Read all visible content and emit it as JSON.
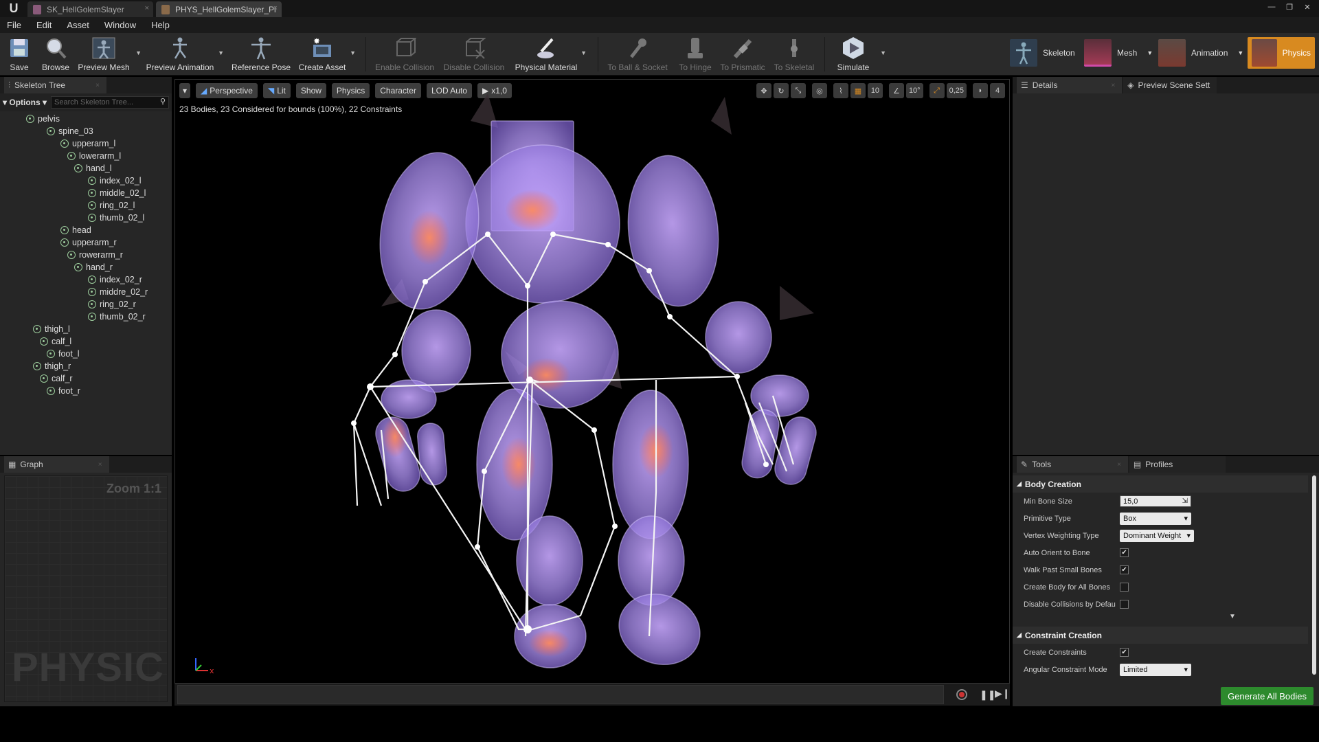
{
  "window": {
    "tabs": [
      {
        "label": "SK_HellGolemSlayer"
      },
      {
        "label": "PHYS_HellGolemSlayer_Pl"
      }
    ]
  },
  "menu": [
    "File",
    "Edit",
    "Asset",
    "Window",
    "Help"
  ],
  "toolbar": {
    "save": "Save",
    "browse": "Browse",
    "preview_mesh": "Preview Mesh",
    "preview_animation": "Preview Animation",
    "reference_pose": "Reference Pose",
    "create_asset": "Create Asset",
    "enable_collision": "Enable Collision",
    "disable_collision": "Disable Collision",
    "physical_material": "Physical Material",
    "to_ball_socket": "To Ball & Socket",
    "to_hinge": "To Hinge",
    "to_prismatic": "To Prismatic",
    "to_skeletal": "To Skeletal",
    "simulate": "Simulate"
  },
  "modes": {
    "skeleton": "Skeleton",
    "mesh": "Mesh",
    "animation": "Animation",
    "physics": "Physics"
  },
  "skeleton_tree": {
    "tab": "Skeleton Tree",
    "options": "Options",
    "search_placeholder": "Search Skeleton Tree...",
    "bones": [
      {
        "name": "pelvis",
        "level": 0
      },
      {
        "name": "spine_03",
        "level": 1
      },
      {
        "name": "upperarm_l",
        "level": 2
      },
      {
        "name": "lowerarm_l",
        "level": 3
      },
      {
        "name": "hand_l",
        "level": 4
      },
      {
        "name": "index_02_l",
        "level": 5
      },
      {
        "name": "middle_02_l",
        "level": 5
      },
      {
        "name": "ring_02_l",
        "level": 5
      },
      {
        "name": "thumb_02_l",
        "level": 5
      },
      {
        "name": "head",
        "level": 2
      },
      {
        "name": "upperarm_r",
        "level": 2
      },
      {
        "name": "rowerarm_r",
        "level": 3
      },
      {
        "name": "hand_r",
        "level": 4
      },
      {
        "name": "index_02_r",
        "level": 5
      },
      {
        "name": "middre_02_r",
        "level": 5
      },
      {
        "name": "ring_02_r",
        "level": 5
      },
      {
        "name": "thumb_02_r",
        "level": 5
      },
      {
        "name": "thigh_l",
        "level": "t0"
      },
      {
        "name": "calf_l",
        "level": "t1"
      },
      {
        "name": "foot_l",
        "level": "t2"
      },
      {
        "name": "thigh_r",
        "level": "t0"
      },
      {
        "name": "calf_r",
        "level": "t1"
      },
      {
        "name": "foot_r",
        "level": "t2"
      }
    ]
  },
  "graph": {
    "tab": "Graph",
    "zoom": "Zoom 1:1",
    "watermark": "PHYSICS"
  },
  "viewport": {
    "menu_arrow": "▾",
    "perspective": "Perspective",
    "lit": "Lit",
    "show": "Show",
    "physics": "Physics",
    "character": "Character",
    "lod": "LOD Auto",
    "speed": "x1,0",
    "info": "23 Bodies, 23 Considered for bounds (100%), 22 Constraints",
    "grid_snap": "10",
    "rot_snap": "10°",
    "scale_snap": "0,25",
    "cam_speed": "4"
  },
  "details": {
    "tab": "Details",
    "tab2": "Preview Scene Sett"
  },
  "tools": {
    "tab": "Tools",
    "tab2": "Profiles",
    "body_section": "Body Creation",
    "min_bone_size_label": "Min Bone Size",
    "min_bone_size": "15,0",
    "primitive_type_label": "Primitive Type",
    "primitive_type": "Box",
    "vertex_weighting_label": "Vertex Weighting Type",
    "vertex_weighting": "Dominant Weight",
    "auto_orient_label": "Auto Orient to Bone",
    "walk_past_label": "Walk Past Small Bones",
    "create_body_label": "Create Body for All Bones",
    "disable_collisions_label": "Disable Collisions by Defau",
    "constraint_section": "Constraint Creation",
    "create_constraints_label": "Create Constraints",
    "angular_mode_label": "Angular Constraint Mode",
    "angular_mode": "Limited",
    "generate": "Generate All Bodies",
    "checks": {
      "auto_orient": true,
      "walk_past": true,
      "create_body": false,
      "disable_collisions": false,
      "create_constraints": true
    }
  },
  "colors": {
    "accent": "#d88a20",
    "bone": "#9ccc9c",
    "body": "#a58ae8",
    "generate": "#2d8a2d"
  }
}
